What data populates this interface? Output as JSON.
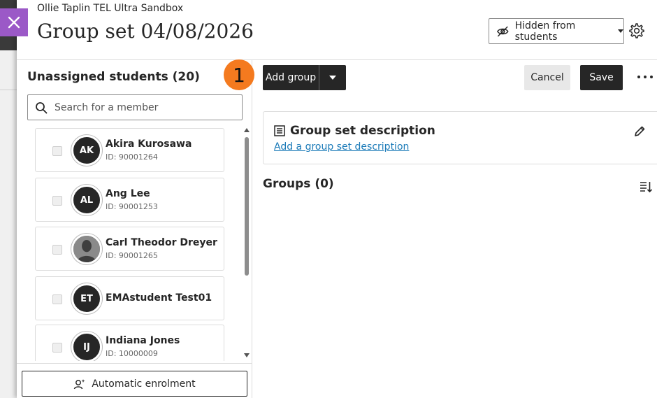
{
  "header": {
    "course_title": "Ollie Taplin TEL Ultra Sandbox",
    "page_title": "Group set 04/08/2026",
    "visibility_label": "Hidden from students"
  },
  "left_panel": {
    "title": "Unassigned students (20)",
    "search_placeholder": "Search for a member",
    "students": [
      {
        "initials": "AK",
        "name": "Akira Kurosawa",
        "id": "ID: 90001264",
        "photo": false
      },
      {
        "initials": "AL",
        "name": "Ang Lee",
        "id": "ID: 90001253",
        "photo": false
      },
      {
        "initials": "",
        "name": "Carl Theodor Dreyer",
        "id": "ID: 90001265",
        "photo": true
      },
      {
        "initials": "ET",
        "name": "EMAstudent Test01",
        "id": "",
        "photo": false
      },
      {
        "initials": "IJ",
        "name": "Indiana Jones",
        "id": "ID: 10000009",
        "photo": false
      }
    ],
    "auto_enrol_label": "Automatic enrolment"
  },
  "step_badge": "1",
  "toolbar": {
    "add_group_label": "Add group",
    "cancel_label": "Cancel",
    "save_label": "Save"
  },
  "description_card": {
    "title": "Group set description",
    "link": "Add a group set description"
  },
  "groups": {
    "title": "Groups (0)"
  },
  "colors": {
    "accent_purple": "#9b59c7",
    "badge_orange": "#f47a1f",
    "dark_button": "#262626",
    "link_blue": "#1a7ab8"
  }
}
